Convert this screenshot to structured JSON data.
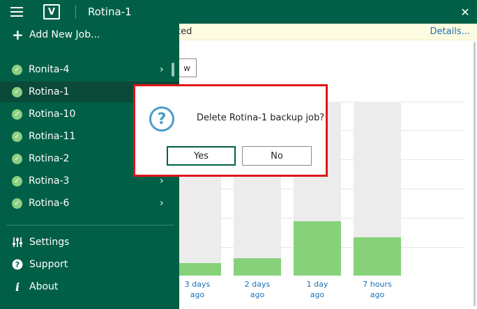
{
  "window": {
    "title": "Rotina-1",
    "close_glyph": "✕",
    "logo_glyph": "V"
  },
  "notice": {
    "text_fragment": "ted",
    "link": "Details..."
  },
  "view_button": {
    "label_fragment": "w"
  },
  "sidebar": {
    "add_job_label": "Add New Job...",
    "jobs": [
      {
        "label": "Ronita-4",
        "status": "success",
        "has_submenu": true,
        "selected": false
      },
      {
        "label": "Rotina-1",
        "status": "success",
        "has_submenu": false,
        "selected": true
      },
      {
        "label": "Rotina-10",
        "status": "success",
        "has_submenu": false,
        "selected": false
      },
      {
        "label": "Rotina-11",
        "status": "success",
        "has_submenu": false,
        "selected": false
      },
      {
        "label": "Rotina-2",
        "status": "success",
        "has_submenu": false,
        "selected": false
      },
      {
        "label": "Rotina-3",
        "status": "success",
        "has_submenu": true,
        "selected": false
      },
      {
        "label": "Rotina-6",
        "status": "success",
        "has_submenu": true,
        "selected": false
      }
    ],
    "footer": [
      {
        "label": "Settings",
        "icon": "settings-sliders-icon"
      },
      {
        "label": "Support",
        "icon": "help-icon"
      },
      {
        "label": "About",
        "icon": "info-icon"
      }
    ]
  },
  "dialog": {
    "message": "Delete Rotina-1 backup job?",
    "yes_label": "Yes",
    "no_label": "No",
    "icon": "question-icon"
  },
  "chart_data": {
    "type": "bar",
    "categories": [
      "3 days ago",
      "2 days ago",
      "1 day ago",
      "7 hours ago"
    ],
    "labels": [
      [
        "3 days",
        "ago"
      ],
      [
        "2 days",
        "ago"
      ],
      [
        "1 day",
        "ago"
      ],
      [
        "7 hours",
        "ago"
      ]
    ],
    "values": [
      7,
      10,
      31,
      22
    ],
    "ylim": [
      0,
      100
    ],
    "grid": true
  },
  "colors": {
    "brand": "#005f46",
    "selected_row": "#0b4a38",
    "success": "#8ccf83",
    "bar_fill": "#86d17a",
    "bar_track": "#ececec",
    "link": "#1a6fb5",
    "dialog_border": "#e0141a",
    "question_icon": "#4b9cc7"
  }
}
